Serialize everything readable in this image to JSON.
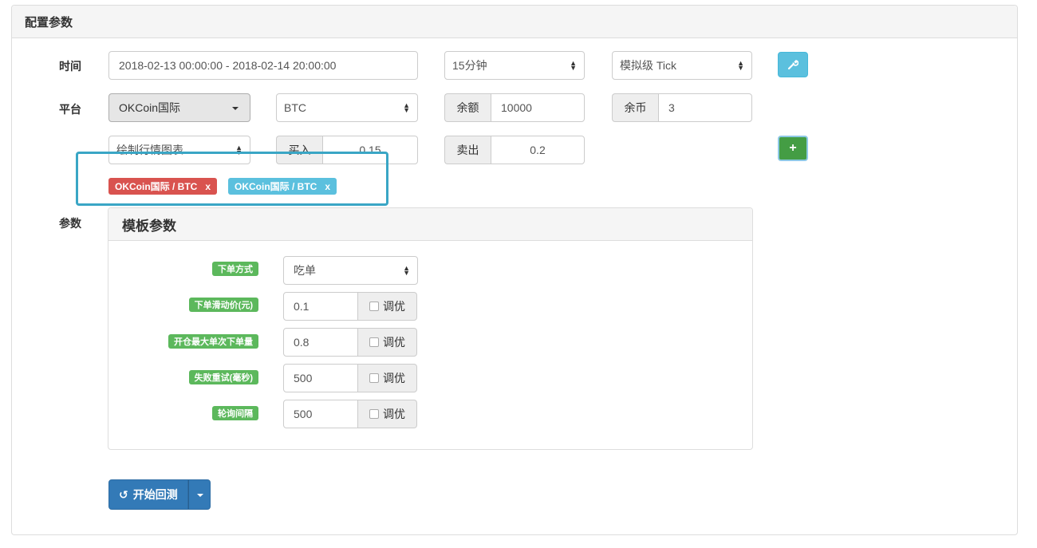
{
  "panel": {
    "title": "配置参数"
  },
  "rows": {
    "time_label": "时间",
    "platform_label": "平台",
    "params_label": "参数"
  },
  "time": {
    "range": "2018-02-13 00:00:00 - 2018-02-14 20:00:00",
    "period": "15分钟",
    "tick_mode": "模拟级 Tick",
    "settings_icon": "wrench-icon"
  },
  "platform": {
    "exchange": "OKCoin国际",
    "currency": "BTC",
    "balance_label": "余额",
    "balance_value": "10000",
    "coins_label": "余币",
    "coins_value": "3",
    "chart_option": "绘制行情图表",
    "buy_label": "买入",
    "buy_value": "0.15",
    "sell_label": "卖出",
    "sell_value": "0.2",
    "add_icon": "plus-icon"
  },
  "tags": [
    {
      "text": "OKCoin国际 / BTC",
      "remove": "x",
      "color": "#d9534f"
    },
    {
      "text": "OKCoin国际 / BTC",
      "remove": "x",
      "color": "#5bc0de"
    }
  ],
  "template": {
    "title": "模板参数",
    "params": [
      {
        "label": "下单方式",
        "value": "吃单",
        "type": "select"
      },
      {
        "label": "下单滑动价(元)",
        "value": "0.1",
        "optimize": "调优"
      },
      {
        "label": "开仓最大单次下单量",
        "value": "0.8",
        "optimize": "调优"
      },
      {
        "label": "失败重试(毫秒)",
        "value": "500",
        "optimize": "调优"
      },
      {
        "label": "轮询间隔",
        "value": "500",
        "optimize": "调优"
      }
    ]
  },
  "run": {
    "label": "开始回测",
    "icon": "history-icon"
  },
  "colors": {
    "primary": "#337ab7",
    "success": "#5cb85c",
    "info": "#5bc0de",
    "danger": "#d9534f",
    "highlight": "#3aa6c5"
  }
}
